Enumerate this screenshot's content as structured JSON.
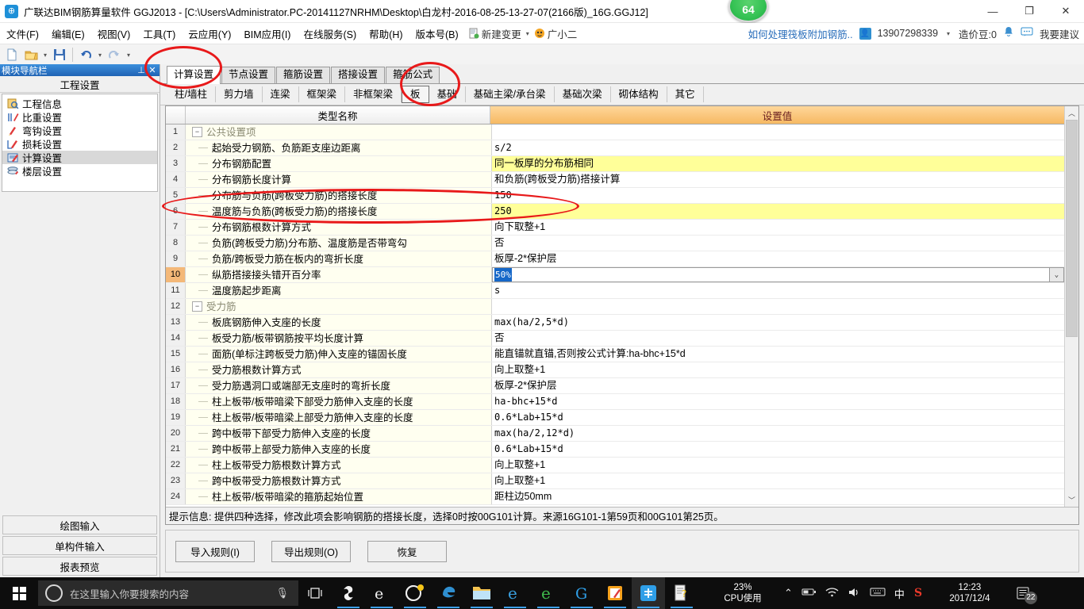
{
  "window": {
    "title": "广联达BIM钢筋算量软件 GGJ2013 - [C:\\Users\\Administrator.PC-20141127NRHM\\Desktop\\白龙村-2016-08-25-13-27-07(2166版)_16G.GGJ12]",
    "badge": "64",
    "minimize": "—",
    "maximize": "❐",
    "close": "✕"
  },
  "menu": {
    "items": [
      "文件(F)",
      "编辑(E)",
      "视图(V)",
      "工具(T)",
      "云应用(Y)",
      "BIM应用(I)",
      "在线服务(S)",
      "帮助(H)",
      "版本号(B)"
    ],
    "new_change": "新建变更",
    "new_change_caret": "▾",
    "assistant": "广小二",
    "right": {
      "tip_link": "如何处理筏板附加钢筋..",
      "phone": "13907298339",
      "phone_caret": "▾",
      "beans": "造价豆:0",
      "suggest": "我要建议"
    }
  },
  "panel": {
    "header_title": "模块导航栏",
    "pin": "⊥",
    "close": "✕",
    "section_title": "工程设置",
    "items": [
      {
        "label": "工程信息",
        "icon": "project-info-icon",
        "selected": false
      },
      {
        "label": "比重设置",
        "icon": "weight-icon",
        "selected": false
      },
      {
        "label": "弯钩设置",
        "icon": "hook-icon",
        "selected": false
      },
      {
        "label": "损耗设置",
        "icon": "loss-icon",
        "selected": false
      },
      {
        "label": "计算设置",
        "icon": "calc-settings-icon",
        "selected": true
      },
      {
        "label": "楼层设置",
        "icon": "floor-icon",
        "selected": false
      }
    ],
    "bottom_buttons": [
      "绘图输入",
      "单构件输入",
      "报表预览"
    ]
  },
  "tabs_primary": [
    {
      "label": "计算设置",
      "active": true
    },
    {
      "label": "节点设置",
      "active": false
    },
    {
      "label": "箍筋设置",
      "active": false
    },
    {
      "label": "搭接设置",
      "active": false
    },
    {
      "label": "箍筋公式",
      "active": false
    }
  ],
  "tabs_secondary": [
    {
      "label": "柱/墙柱",
      "active": false
    },
    {
      "label": "剪力墙",
      "active": false
    },
    {
      "label": "连梁",
      "active": false
    },
    {
      "label": "框架梁",
      "active": false
    },
    {
      "label": "非框架梁",
      "active": false
    },
    {
      "label": "板",
      "active": true
    },
    {
      "label": "基础",
      "active": false
    },
    {
      "label": "基础主梁/承台梁",
      "active": false
    },
    {
      "label": "基础次梁",
      "active": false
    },
    {
      "label": "砌体结构",
      "active": false
    },
    {
      "label": "其它",
      "active": false
    }
  ],
  "grid": {
    "headers": {
      "num": "",
      "name": "类型名称",
      "value": "设置值"
    },
    "rows": [
      {
        "n": "1",
        "name": "公共设置项",
        "value": "",
        "type": "group",
        "highlight": false
      },
      {
        "n": "2",
        "name": "起始受力钢筋、负筋距支座边距离",
        "value": "s/2",
        "type": "item",
        "highlight": false
      },
      {
        "n": "3",
        "name": "分布钢筋配置",
        "value": "同一板厚的分布筋相同",
        "type": "item",
        "highlight": true,
        "cn": true
      },
      {
        "n": "4",
        "name": "分布钢筋长度计算",
        "value": "和负筋(跨板受力筋)搭接计算",
        "type": "item",
        "highlight": false,
        "cn": true
      },
      {
        "n": "5",
        "name": "分布筋与负筋(跨板受力筋)的搭接长度",
        "value": "150",
        "type": "item",
        "highlight": false
      },
      {
        "n": "6",
        "name": "温度筋与负筋(跨板受力筋)的搭接长度",
        "value": "250",
        "type": "item",
        "highlight": true
      },
      {
        "n": "7",
        "name": "分布钢筋根数计算方式",
        "value": "向下取整+1",
        "type": "item",
        "highlight": false,
        "cn": true
      },
      {
        "n": "8",
        "name": "负筋(跨板受力筋)分布筋、温度筋是否带弯勾",
        "value": "否",
        "type": "item",
        "highlight": false,
        "cn": true
      },
      {
        "n": "9",
        "name": "负筋/跨板受力筋在板内的弯折长度",
        "value": "板厚-2*保护层",
        "type": "item",
        "highlight": false,
        "cn": true
      },
      {
        "n": "10",
        "name": "纵筋搭接接头错开百分率",
        "value": "50%",
        "type": "editing",
        "highlight": false
      },
      {
        "n": "11",
        "name": "温度筋起步距离",
        "value": "s",
        "type": "item",
        "highlight": false
      },
      {
        "n": "12",
        "name": "受力筋",
        "value": "",
        "type": "group",
        "highlight": false
      },
      {
        "n": "13",
        "name": "板底钢筋伸入支座的长度",
        "value": "max(ha/2,5*d)",
        "type": "item",
        "highlight": false
      },
      {
        "n": "14",
        "name": "板受力筋/板带钢筋按平均长度计算",
        "value": "否",
        "type": "item",
        "highlight": false,
        "cn": true
      },
      {
        "n": "15",
        "name": "面筋(单标注跨板受力筋)伸入支座的锚固长度",
        "value": "能直锚就直锚,否则按公式计算:ha-bhc+15*d",
        "type": "item",
        "highlight": false,
        "cn": true
      },
      {
        "n": "16",
        "name": "受力筋根数计算方式",
        "value": "向上取整+1",
        "type": "item",
        "highlight": false,
        "cn": true
      },
      {
        "n": "17",
        "name": "受力筋遇洞口或端部无支座时的弯折长度",
        "value": "板厚-2*保护层",
        "type": "item",
        "highlight": false,
        "cn": true
      },
      {
        "n": "18",
        "name": "柱上板带/板带暗梁下部受力筋伸入支座的长度",
        "value": "ha-bhc+15*d",
        "type": "item",
        "highlight": false
      },
      {
        "n": "19",
        "name": "柱上板带/板带暗梁上部受力筋伸入支座的长度",
        "value": "0.6*Lab+15*d",
        "type": "item",
        "highlight": false
      },
      {
        "n": "20",
        "name": "跨中板带下部受力筋伸入支座的长度",
        "value": "max(ha/2,12*d)",
        "type": "item",
        "highlight": false
      },
      {
        "n": "21",
        "name": "跨中板带上部受力筋伸入支座的长度",
        "value": "0.6*Lab+15*d",
        "type": "item",
        "highlight": false
      },
      {
        "n": "22",
        "name": "柱上板带受力筋根数计算方式",
        "value": "向上取整+1",
        "type": "item",
        "highlight": false,
        "cn": true
      },
      {
        "n": "23",
        "name": "跨中板带受力筋根数计算方式",
        "value": "向上取整+1",
        "type": "item",
        "highlight": false,
        "cn": true
      },
      {
        "n": "24",
        "name": "柱上板带/板带暗梁的箍筋起始位置",
        "value": "距柱边50mm",
        "type": "item",
        "highlight": false,
        "cn": true
      }
    ],
    "current_row": "10",
    "scroll_up": "︿",
    "scroll_down": "﹀",
    "dropdown_caret": "⌄"
  },
  "hint": "提示信息: 提供四种选择，修改此项会影响钢筋的搭接长度，选择0时按00G101计算。来源16G101-1第59页和00G101第25页。",
  "footer_buttons": [
    "导入规则(I)",
    "导出规则(O)",
    "恢复"
  ],
  "taskbar": {
    "search_placeholder": "在这里输入你要搜索的内容",
    "cpu_percent": "23%",
    "cpu_label": "CPU使用",
    "time": "12:23",
    "date": "2017/12/4",
    "notif_count": "22",
    "ime": "中",
    "tray_caret": "⌃"
  },
  "colors": {
    "accent_header": "#f6b963",
    "highlight_row": "#ffff99",
    "annotation": "#e8191a",
    "selection": "#1667c8"
  }
}
